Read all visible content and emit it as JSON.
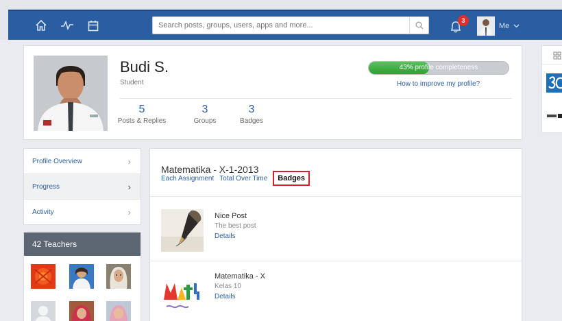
{
  "nav": {
    "search_placeholder": "Search posts, groups, users, apps and more...",
    "notification_count": "3",
    "me_label": "Me"
  },
  "profile": {
    "name": "Budi S.",
    "role": "Student",
    "stats": [
      {
        "value": "5",
        "label": "Posts & Replies"
      },
      {
        "value": "3",
        "label": "Groups"
      },
      {
        "value": "3",
        "label": "Badges"
      }
    ],
    "completeness_text": "43% profile completeness",
    "completeness_fraction": 0.43,
    "improve_link": "How to improve my profile?"
  },
  "menu": {
    "items": [
      {
        "label": "Profile Overview"
      },
      {
        "label": "Progress"
      },
      {
        "label": "Activity"
      }
    ]
  },
  "teachers": {
    "heading": "42 Teachers"
  },
  "main": {
    "course_title": "Matematika - X-1-2013",
    "tabs": [
      {
        "label": "Each Assignment"
      },
      {
        "label": "Total Over Time"
      },
      {
        "label": "Badges"
      }
    ],
    "badges": [
      {
        "title": "Nice Post",
        "description": "The best post",
        "link": "Details"
      },
      {
        "title": "Matematika - X",
        "description": "Kelas 10",
        "link": "Details"
      }
    ]
  },
  "colors": {
    "navbar": "#2b5ea1",
    "link": "#2b5ea1",
    "progress_fill": "#3aa93f",
    "notification": "#d9322a",
    "highlight_border": "#d0202a"
  }
}
